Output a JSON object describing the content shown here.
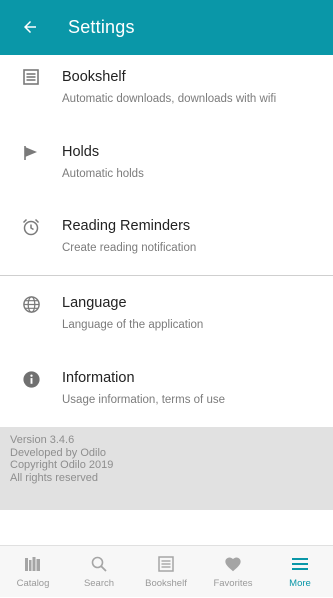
{
  "header": {
    "back_icon": "arrow-left-icon",
    "title": "Settings"
  },
  "settings": {
    "items": [
      {
        "icon": "bookshelf-icon",
        "title": "Bookshelf",
        "subtitle": "Automatic downloads, downloads with wifi"
      },
      {
        "icon": "flag-icon",
        "title": "Holds",
        "subtitle": "Automatic holds"
      },
      {
        "icon": "alarm-clock-icon",
        "title": "Reading Reminders",
        "subtitle": "Create reading notification"
      },
      {
        "icon": "globe-icon",
        "title": "Language",
        "subtitle": "Language of the application"
      },
      {
        "icon": "info-icon",
        "title": "Information",
        "subtitle": "Usage information, terms of use"
      }
    ]
  },
  "version": {
    "lines": [
      "Version 3.4.6",
      "Developed by Odilo",
      "Copyright Odilo 2019",
      "All rights reserved"
    ]
  },
  "bottom_nav": {
    "items": [
      {
        "icon": "catalog-icon",
        "label": "Catalog",
        "active": false
      },
      {
        "icon": "search-icon",
        "label": "Search",
        "active": false
      },
      {
        "icon": "bookshelf-icon",
        "label": "Bookshelf",
        "active": false
      },
      {
        "icon": "heart-icon",
        "label": "Favorites",
        "active": false
      },
      {
        "icon": "menu-icon",
        "label": "More",
        "active": true
      }
    ]
  },
  "colors": {
    "accent": "#0a97a8",
    "inactive_nav": "#9a9a9a",
    "version_bg": "#e1e1e1"
  }
}
